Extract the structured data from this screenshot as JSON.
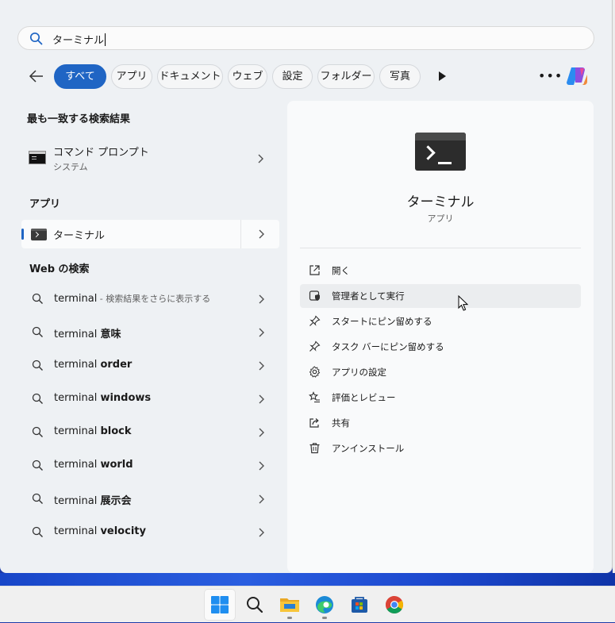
{
  "search": {
    "query": "ターミナル"
  },
  "filters": [
    {
      "label": "すべて",
      "active": true
    },
    {
      "label": "アプリ"
    },
    {
      "label": "ドキュメント"
    },
    {
      "label": "ウェブ"
    },
    {
      "label": "設定"
    },
    {
      "label": "フォルダー"
    },
    {
      "label": "写真"
    }
  ],
  "left": {
    "best_match_title": "最も一致する検索結果",
    "best_match": {
      "title": "コマンド プロンプト",
      "subtitle": "システム",
      "icon": "command-prompt-icon"
    },
    "apps_title": "アプリ",
    "apps": [
      {
        "label": "ターミナル",
        "icon": "terminal-icon"
      }
    ],
    "web_title": "Web の検索",
    "web": [
      {
        "prefix": "terminal",
        "bold": "",
        "hint": " - 検索結果をさらに表示する"
      },
      {
        "prefix": "terminal ",
        "bold": "意味",
        "hint": ""
      },
      {
        "prefix": "terminal ",
        "bold": "order",
        "hint": ""
      },
      {
        "prefix": "terminal ",
        "bold": "windows",
        "hint": ""
      },
      {
        "prefix": "terminal ",
        "bold": "block",
        "hint": ""
      },
      {
        "prefix": "terminal ",
        "bold": "world",
        "hint": ""
      },
      {
        "prefix": "terminal ",
        "bold": "展示会",
        "hint": ""
      },
      {
        "prefix": "terminal ",
        "bold": "velocity",
        "hint": ""
      }
    ]
  },
  "detail": {
    "title": "ターミナル",
    "subtitle": "アプリ",
    "actions": [
      {
        "label": "開く",
        "icon": "open-external-icon"
      },
      {
        "label": "管理者として実行",
        "icon": "shield-admin-icon",
        "hover": true
      },
      {
        "label": "スタートにピン留めする",
        "icon": "pin-icon"
      },
      {
        "label": "タスク バーにピン留めする",
        "icon": "pin-icon"
      },
      {
        "label": "アプリの設定",
        "icon": "gear-icon"
      },
      {
        "label": "評価とレビュー",
        "icon": "star-list-icon"
      },
      {
        "label": "共有",
        "icon": "share-icon"
      },
      {
        "label": "アンインストール",
        "icon": "trash-icon"
      }
    ]
  },
  "taskbar": [
    {
      "name": "start",
      "icon": "windows-logo-icon"
    },
    {
      "name": "search",
      "icon": "search-icon"
    },
    {
      "name": "file-explorer",
      "icon": "folder-icon"
    },
    {
      "name": "edge",
      "icon": "edge-icon"
    },
    {
      "name": "store",
      "icon": "store-icon"
    },
    {
      "name": "chrome",
      "icon": "chrome-icon"
    }
  ],
  "colors": {
    "accent": "#1f65c4",
    "panel": "#eef1f4",
    "detail": "#f9fafb"
  }
}
